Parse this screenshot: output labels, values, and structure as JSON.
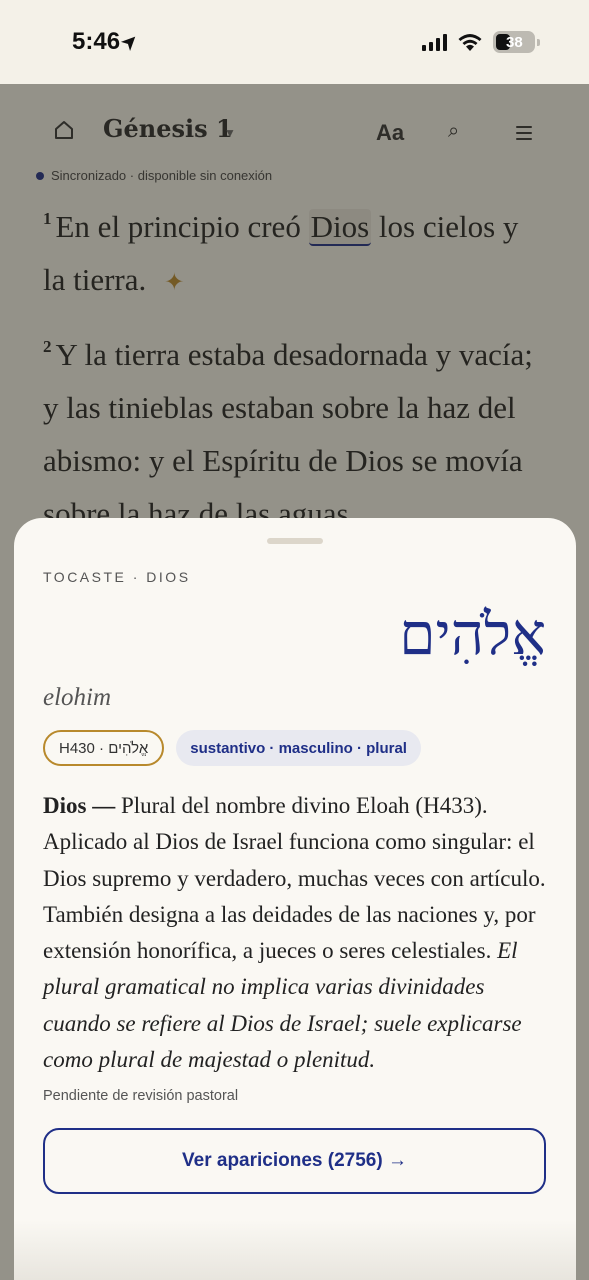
{
  "status": {
    "time": "5:46",
    "battery": "38"
  },
  "reader": {
    "book_title": "Génesis 1",
    "font_button": "Aa",
    "sync_status": "Sincronizado · disponible sin conexión",
    "verses": [
      {
        "number": "1",
        "text_before": "En el principio creó ",
        "highlighted_word": "Dios",
        "text_after": " los cielos y la tierra."
      },
      {
        "number": "2",
        "text": "Y la tierra estaba desadornada y vacía; y las tinieblas estaban sobre la haz del abismo: y el Espíritu de Dios se movía sobre la haz de las aguas."
      }
    ]
  },
  "sheet": {
    "eyebrow": "TOCASTE · DIOS",
    "hebrew": "אֱלֹהִים",
    "transliteration": "elohim",
    "strong_chip": "H430 · אֱלֹהִים",
    "pos_chip": "sustantivo · masculino · plural",
    "definition": {
      "headword": "Dios —",
      "body": " Plural del nombre divino Eloah (H433). Aplicado al Dios de Israel funciona como singular: el Dios supremo y verdadero, muchas veces con artículo. También designa a las deidades de las naciones y, por extensión honorífica, a jueces o seres celestiales. ",
      "italic_note": "El plural gramatical no implica varias divinidades cuando se refiere al Dios de Israel; suele explicarse como plural de majestad o plenitud."
    },
    "review_note": "Pendiente de revisión pastoral",
    "occurrences_button": "Ver apariciones (2756) →"
  },
  "colors": {
    "accent_blue": "#1f2f87",
    "accent_gold": "#b8892c",
    "paper": "#f4f1e8",
    "sheet": "#faf8f3"
  },
  "icons": [
    "home-icon",
    "caret-down-icon",
    "search-icon",
    "menu-icon",
    "sparkle-icon",
    "location-arrow-icon",
    "signal-icon",
    "wifi-icon",
    "battery-icon"
  ]
}
